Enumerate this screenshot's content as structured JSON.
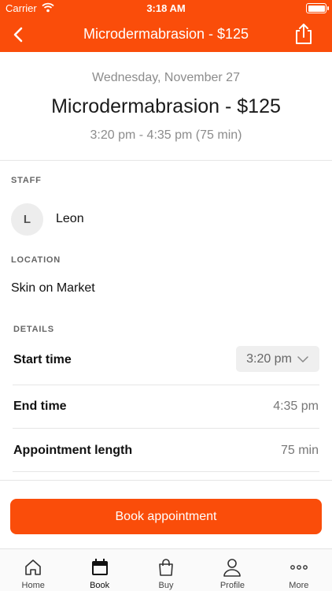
{
  "status_bar": {
    "carrier": "Carrier",
    "time": "3:18 AM"
  },
  "nav": {
    "title": "Microdermabrasion - $125",
    "back_icon": "chevron-left-icon",
    "share_icon": "share-icon"
  },
  "header": {
    "date": "Wednesday, November 27",
    "service": "Microdermabrasion - $125",
    "time_range": "3:20 pm - 4:35 pm (75 min)"
  },
  "staff": {
    "section_label": "STAFF",
    "initial": "L",
    "name": "Leon"
  },
  "location": {
    "section_label": "LOCATION",
    "name": "Skin on Market"
  },
  "details": {
    "section_label": "DETAILS",
    "start_time_label": "Start time",
    "start_time_value": "3:20 pm",
    "end_time_label": "End time",
    "end_time_value": "4:35 pm",
    "length_label": "Appointment length",
    "length_value": "75 min"
  },
  "actions": {
    "book_label": "Book appointment"
  },
  "tabs": [
    {
      "label": "Home",
      "icon": "home-icon"
    },
    {
      "label": "Book",
      "icon": "calendar-icon",
      "active": true
    },
    {
      "label": "Buy",
      "icon": "shopping-bag-icon"
    },
    {
      "label": "Profile",
      "icon": "person-icon"
    },
    {
      "label": "More",
      "icon": "more-dots-icon"
    }
  ],
  "colors": {
    "brand": "#fa4d0a",
    "muted_text": "#8c8c8c"
  }
}
